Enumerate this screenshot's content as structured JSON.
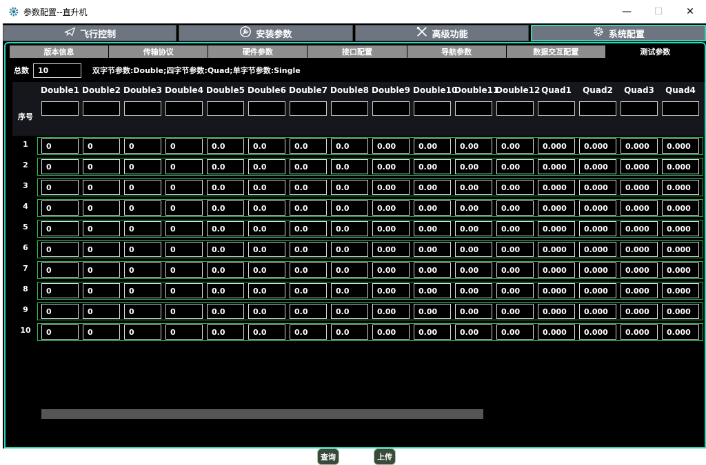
{
  "window": {
    "title": "参数配置--直升机",
    "minimize": "—",
    "maximize": "☐",
    "close": "✕"
  },
  "top_tabs": [
    {
      "label": "飞行控制",
      "icon": "airplane-icon"
    },
    {
      "label": "安装参数",
      "icon": "wrench-icon"
    },
    {
      "label": "高级功能",
      "icon": "tools-icon"
    },
    {
      "label": "系统配置",
      "icon": "gear-icon",
      "active": true
    }
  ],
  "sub_tabs": [
    {
      "label": "版本信息"
    },
    {
      "label": "传输协议"
    },
    {
      "label": "硬件参数"
    },
    {
      "label": "接口配置"
    },
    {
      "label": "导航参数"
    },
    {
      "label": "数据交互配置"
    },
    {
      "label": "测试参数",
      "active": true
    }
  ],
  "total": {
    "label": "总数",
    "value": "10"
  },
  "hint": "双字节参数:Double;四字节参数:Quad;单字节参数:Single",
  "table": {
    "seq_header": "序号",
    "columns": [
      "Double1",
      "Double2",
      "Double3",
      "Double4",
      "Double5",
      "Double6",
      "Double7",
      "Double8",
      "Double9",
      "Double10",
      "Double11",
      "Double12",
      "Quad1",
      "Quad2",
      "Quad3",
      "Quad4"
    ],
    "rows": [
      {
        "num": "1",
        "cells": [
          "0",
          "0",
          "0",
          "0",
          "0.0",
          "0.0",
          "0.0",
          "0.0",
          "0.00",
          "0.00",
          "0.00",
          "0.00",
          "0.000",
          "0.000",
          "0.000",
          "0.000"
        ]
      },
      {
        "num": "2",
        "cells": [
          "0",
          "0",
          "0",
          "0",
          "0.0",
          "0.0",
          "0.0",
          "0.0",
          "0.00",
          "0.00",
          "0.00",
          "0.00",
          "0.000",
          "0.000",
          "0.000",
          "0.000"
        ]
      },
      {
        "num": "3",
        "cells": [
          "0",
          "0",
          "0",
          "0",
          "0.0",
          "0.0",
          "0.0",
          "0.0",
          "0.00",
          "0.00",
          "0.00",
          "0.00",
          "0.000",
          "0.000",
          "0.000",
          "0.000"
        ]
      },
      {
        "num": "4",
        "cells": [
          "0",
          "0",
          "0",
          "0",
          "0.0",
          "0.0",
          "0.0",
          "0.0",
          "0.00",
          "0.00",
          "0.00",
          "0.00",
          "0.000",
          "0.000",
          "0.000",
          "0.000"
        ]
      },
      {
        "num": "5",
        "cells": [
          "0",
          "0",
          "0",
          "0",
          "0.0",
          "0.0",
          "0.0",
          "0.0",
          "0.00",
          "0.00",
          "0.00",
          "0.00",
          "0.000",
          "0.000",
          "0.000",
          "0.000"
        ]
      },
      {
        "num": "6",
        "cells": [
          "0",
          "0",
          "0",
          "0",
          "0.0",
          "0.0",
          "0.0",
          "0.0",
          "0.00",
          "0.00",
          "0.00",
          "0.00",
          "0.000",
          "0.000",
          "0.000",
          "0.000"
        ]
      },
      {
        "num": "7",
        "cells": [
          "0",
          "0",
          "0",
          "0",
          "0.0",
          "0.0",
          "0.0",
          "0.0",
          "0.00",
          "0.00",
          "0.00",
          "0.00",
          "0.000",
          "0.000",
          "0.000",
          "0.000"
        ]
      },
      {
        "num": "8",
        "cells": [
          "0",
          "0",
          "0",
          "0",
          "0.0",
          "0.0",
          "0.0",
          "0.0",
          "0.00",
          "0.00",
          "0.00",
          "0.00",
          "0.000",
          "0.000",
          "0.000",
          "0.000"
        ]
      },
      {
        "num": "9",
        "cells": [
          "0",
          "0",
          "0",
          "0",
          "0.0",
          "0.0",
          "0.0",
          "0.0",
          "0.00",
          "0.00",
          "0.00",
          "0.00",
          "0.000",
          "0.000",
          "0.000",
          "0.000"
        ]
      },
      {
        "num": "10",
        "cells": [
          "0",
          "0",
          "0",
          "0",
          "0.0",
          "0.0",
          "0.0",
          "0.0",
          "0.00",
          "0.00",
          "0.00",
          "0.00",
          "0.000",
          "0.000",
          "0.000",
          "0.000"
        ]
      }
    ]
  },
  "buttons": {
    "query": "查询",
    "upload": "上传"
  },
  "colors": {
    "accent": "#2fd6b7",
    "row_border": "#2cc05a",
    "tab_bg": "#6c7580",
    "subtab_bg": "#8d8d8d"
  }
}
